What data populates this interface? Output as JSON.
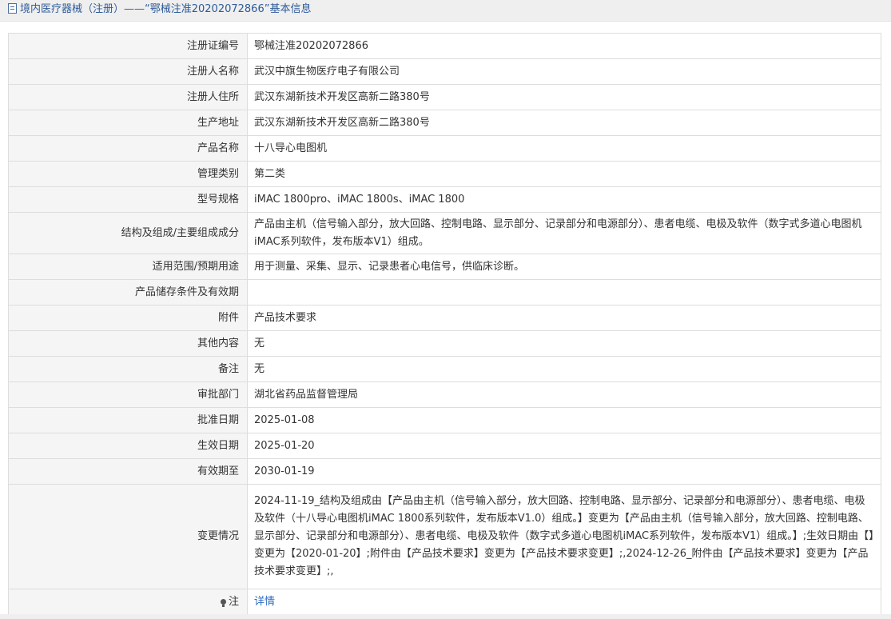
{
  "header": {
    "title": "境内医疗器械（注册）——“鄂械注准20202072866”基本信息"
  },
  "rows": [
    {
      "label": "注册证编号",
      "value": "鄂械注准20202072866"
    },
    {
      "label": "注册人名称",
      "value": "武汉中旗生物医疗电子有限公司"
    },
    {
      "label": "注册人住所",
      "value": "武汉东湖新技术开发区高新二路380号"
    },
    {
      "label": "生产地址",
      "value": "武汉东湖新技术开发区高新二路380号"
    },
    {
      "label": "产品名称",
      "value": "十八导心电图机"
    },
    {
      "label": "管理类别",
      "value": "第二类"
    },
    {
      "label": "型号规格",
      "value": "iMAC 1800pro、iMAC 1800s、iMAC 1800"
    },
    {
      "label": "结构及组成/主要组成成分",
      "value": "产品由主机（信号输入部分，放大回路、控制电路、显示部分、记录部分和电源部分）、患者电缆、电极及软件（数字式多道心电图机iMAC系列软件，发布版本V1）组成。"
    },
    {
      "label": "适用范围/预期用途",
      "value": "用于测量、采集、显示、记录患者心电信号，供临床诊断。"
    },
    {
      "label": "产品储存条件及有效期",
      "value": ""
    },
    {
      "label": "附件",
      "value": "产品技术要求"
    },
    {
      "label": "其他内容",
      "value": "无"
    },
    {
      "label": "备注",
      "value": "无"
    },
    {
      "label": "审批部门",
      "value": "湖北省药品监督管理局"
    },
    {
      "label": "批准日期",
      "value": "2025-01-08"
    },
    {
      "label": "生效日期",
      "value": "2025-01-20"
    },
    {
      "label": "有效期至",
      "value": "2030-01-19"
    },
    {
      "label": "变更情况",
      "value": "2024-11-19_结构及组成由【产品由主机（信号输入部分，放大回路、控制电路、显示部分、记录部分和电源部分）、患者电缆、电极及软件（十八导心电图机iMAC 1800系列软件，发布版本V1.0）组成。】变更为【产品由主机（信号输入部分，放大回路、控制电路、显示部分、记录部分和电源部分）、患者电缆、电极及软件（数字式多道心电图机iMAC系列软件，发布版本V1）组成。】;生效日期由【】变更为【2020-01-20】;附件由【产品技术要求】变更为【产品技术要求变更】;,2024-12-26_附件由【产品技术要求】变更为【产品技术要求变更】;,"
    }
  ],
  "note": {
    "label": "注",
    "link": "详情",
    "icon": "lightbulb-icon"
  }
}
